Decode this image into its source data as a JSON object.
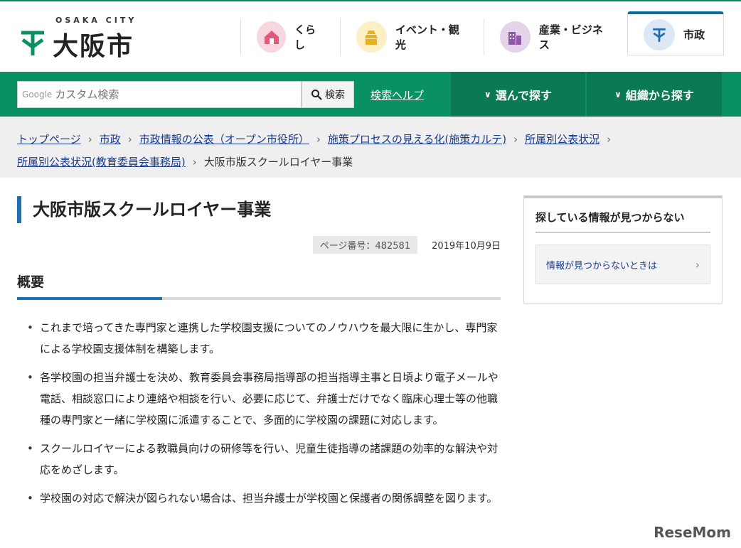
{
  "header": {
    "logo_sub": "OSAKA CITY",
    "logo_name": "大阪市",
    "nav": [
      {
        "label": "くらし",
        "icon": "house-icon",
        "color": "#f8d6df"
      },
      {
        "label": "イベント・観光",
        "icon": "castle-icon",
        "color": "#fcefc4"
      },
      {
        "label": "産業・ビジネス",
        "icon": "building-icon",
        "color": "#e4d3ea"
      },
      {
        "label": "市政",
        "icon": "city-emblem-icon",
        "color": "#dce8f5"
      }
    ]
  },
  "search": {
    "google_label": "Google",
    "placeholder": "カスタム検索",
    "button": "検索",
    "help": "検索ヘルプ"
  },
  "menus": {
    "browse": "選んで探す",
    "org": "組織から探す"
  },
  "breadcrumb": {
    "items": [
      "トップページ",
      "市政",
      "市政情報の公表（オープン市役所）",
      "施策プロセスの見える化(施策カルテ)",
      "所属別公表状況",
      "所属別公表状況(教育委員会事務局)"
    ],
    "current": "大阪市版スクールロイヤー事業"
  },
  "article": {
    "title": "大阪市版スクールロイヤー事業",
    "page_number": "ページ番号：482581",
    "date": "2019年10月9日",
    "section": "概要",
    "bullets": [
      "これまで培ってきた専門家と連携した学校園支援についてのノウハウを最大限に生かし、専門家による学校園支援体制を構築します。",
      "各学校園の担当弁護士を決め、教育委員会事務局指導部の担当指導主事と日頃より電子メールや電話、相談窓口により連絡や相談を行い、必要に応じて、弁護士だけでなく臨床心理士等の他職種の専門家と一緒に学校園に派遣することで、多面的に学校園の課題に対応します。",
      "スクールロイヤーによる教職員向けの研修等を行い、児童生徒指導の諸課題の効率的な解決や対応をめざします。",
      "学校園の対応で解決が図られない場合は、担当弁護士が学校園と保護者の関係調整を図ります。"
    ]
  },
  "side": {
    "title": "探している情報が見つからない",
    "link": "情報が見つからないときは"
  },
  "watermark": "ReseMom",
  "colors": {
    "green": "#0a9163",
    "green_dark": "#0b7a53",
    "accent_blue": "#1f6fb2",
    "link": "#1a3a8a"
  }
}
